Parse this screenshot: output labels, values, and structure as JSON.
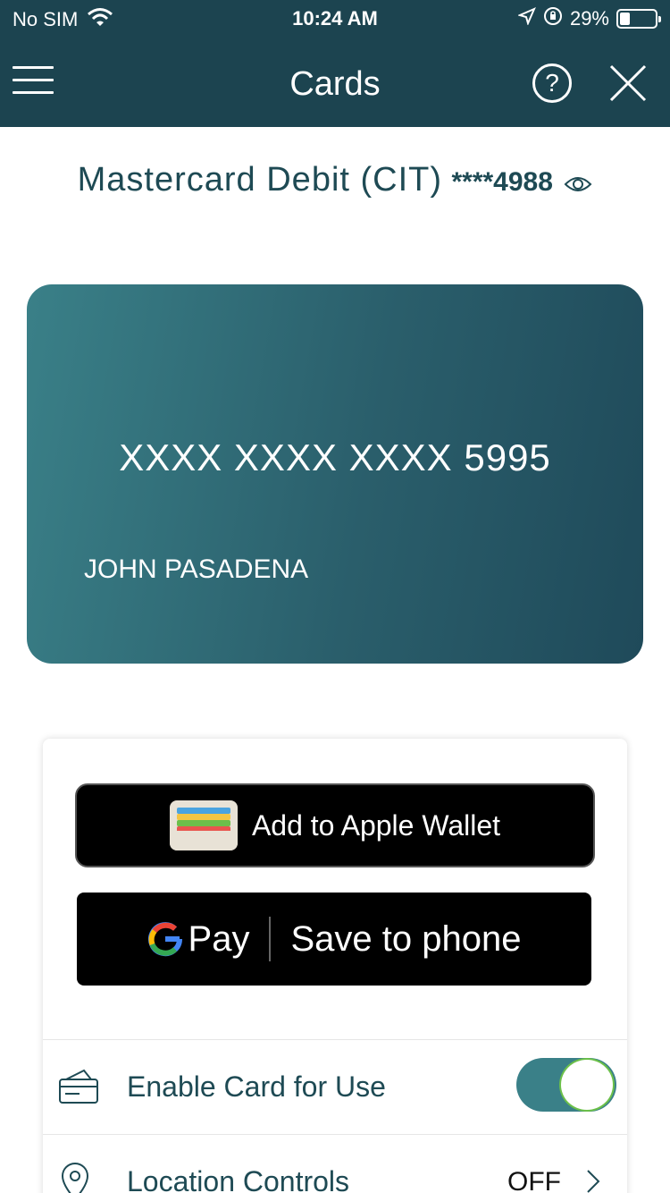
{
  "status_bar": {
    "carrier": "No SIM",
    "time": "10:24 AM",
    "battery": "29%",
    "battery_level": 0.29
  },
  "header": {
    "title": "Cards"
  },
  "card_heading": {
    "name": "Mastercard Debit (CIT)",
    "masked_number": "****4988"
  },
  "card": {
    "number": "XXXX XXXX XXXX 5995",
    "holder": "JOHN PASADENA"
  },
  "wallet": {
    "apple_label": "Add to Apple Wallet",
    "gpay_brand": "Pay",
    "gpay_label": "Save to phone"
  },
  "settings": [
    {
      "label": "Enable Card for Use",
      "toggle_on": true
    },
    {
      "label": "Location Controls",
      "value": "OFF"
    }
  ],
  "colors": {
    "header_bg": "#1c4450",
    "accent": "#3a8088",
    "text": "#1e4a54"
  }
}
